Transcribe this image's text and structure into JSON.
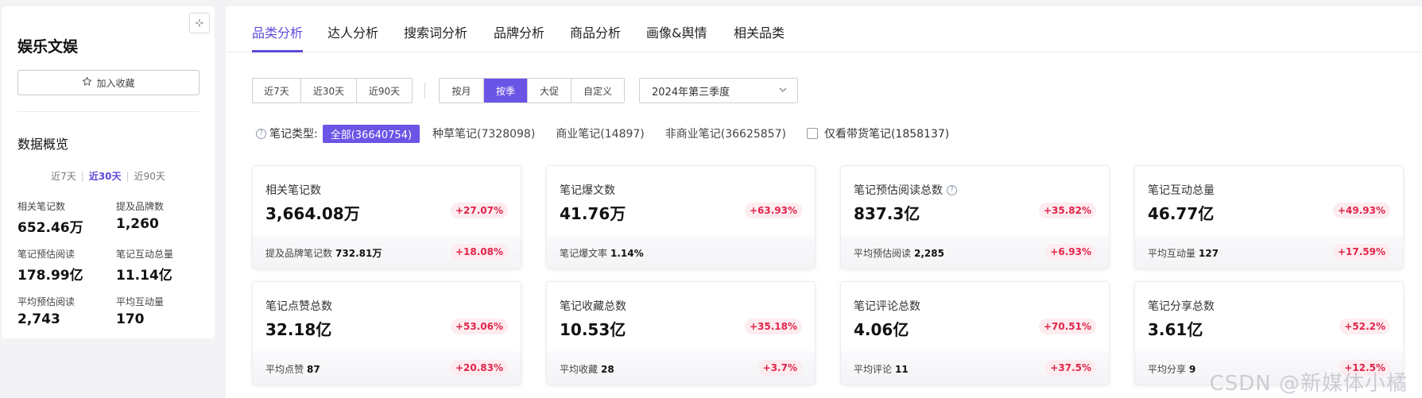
{
  "sidebar": {
    "collapse_glyph": "⊹",
    "title": "娱乐文娱",
    "favorite_label": "加入收藏",
    "overview_title": "数据概览",
    "periods": [
      {
        "label": "近7天",
        "active": false
      },
      {
        "label": "近30天",
        "active": true
      },
      {
        "label": "近90天",
        "active": false
      }
    ],
    "stats": [
      {
        "label": "相关笔记数",
        "value": "652.46万"
      },
      {
        "label": "提及品牌数",
        "value": "1,260"
      },
      {
        "label": "笔记预估阅读",
        "value": "178.99亿"
      },
      {
        "label": "笔记互动总量",
        "value": "11.14亿"
      },
      {
        "label": "平均预估阅读",
        "value": "2,743"
      },
      {
        "label": "平均互动量",
        "value": "170"
      }
    ]
  },
  "tabs": [
    {
      "label": "品类分析",
      "active": true
    },
    {
      "label": "达人分析",
      "active": false
    },
    {
      "label": "搜索词分析",
      "active": false
    },
    {
      "label": "品牌分析",
      "active": false
    },
    {
      "label": "商品分析",
      "active": false
    },
    {
      "label": "画像&舆情",
      "active": false
    },
    {
      "label": "相关品类",
      "active": false
    }
  ],
  "range_options": [
    "近7天",
    "近30天",
    "近90天"
  ],
  "granularity_options": [
    {
      "label": "按月",
      "active": false
    },
    {
      "label": "按季",
      "active": true
    },
    {
      "label": "大促",
      "active": false
    },
    {
      "label": "自定义",
      "active": false
    }
  ],
  "period_select": {
    "value": "2024年第三季度"
  },
  "note_filter": {
    "label": "笔记类型:",
    "active_chip": "全部(36640754)",
    "chips": [
      "种草笔记(7328098)",
      "商业笔记(14897)",
      "非商业笔记(36625857)"
    ],
    "checkbox_label": "仅看带货笔记(1858137)"
  },
  "cards": [
    {
      "title": "相关笔记数",
      "value": "3,664.08万",
      "change": "+27.07%",
      "foot_label": "提及品牌笔记数",
      "foot_value": "732.81万",
      "foot_change": "+18.08%",
      "help": false
    },
    {
      "title": "笔记爆文数",
      "value": "41.76万",
      "change": "+63.93%",
      "foot_label": "笔记爆文率",
      "foot_value": "1.14%",
      "foot_change": "",
      "help": false
    },
    {
      "title": "笔记预估阅读总数",
      "value": "837.3亿",
      "change": "+35.82%",
      "foot_label": "平均预估阅读",
      "foot_value": "2,285",
      "foot_change": "+6.93%",
      "help": true
    },
    {
      "title": "笔记互动总量",
      "value": "46.77亿",
      "change": "+49.93%",
      "foot_label": "平均互动量",
      "foot_value": "127",
      "foot_change": "+17.59%",
      "help": false
    },
    {
      "title": "笔记点赞总数",
      "value": "32.18亿",
      "change": "+53.06%",
      "foot_label": "平均点赞",
      "foot_value": "87",
      "foot_change": "+20.83%",
      "help": false
    },
    {
      "title": "笔记收藏总数",
      "value": "10.53亿",
      "change": "+35.18%",
      "foot_label": "平均收藏",
      "foot_value": "28",
      "foot_change": "+3.7%",
      "help": false
    },
    {
      "title": "笔记评论总数",
      "value": "4.06亿",
      "change": "+70.51%",
      "foot_label": "平均评论",
      "foot_value": "11",
      "foot_change": "+37.5%",
      "help": false
    },
    {
      "title": "笔记分享总数",
      "value": "3.61亿",
      "change": "+52.2%",
      "foot_label": "平均分享",
      "foot_value": "9",
      "foot_change": "+12.5%",
      "help": false
    }
  ],
  "watermark": "CSDN @新媒体小橘",
  "colors": {
    "accent": "#6a55e6",
    "positive": "#e0254b",
    "positive_bg": "#fdecef"
  }
}
